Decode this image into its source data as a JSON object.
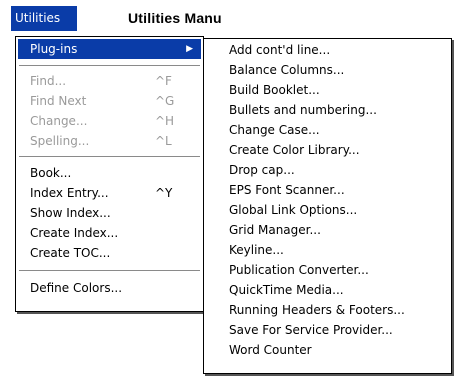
{
  "menubar": {
    "active_menu": "Utilities"
  },
  "caption": "Utilities  Manu",
  "utilities_menu": {
    "plugins": {
      "label": "Plug-ins",
      "arrow": "▶"
    },
    "find": {
      "label": "Find...",
      "shortcut": "^F"
    },
    "find_next": {
      "label": "Find Next",
      "shortcut": "^G"
    },
    "change": {
      "label": "Change...",
      "shortcut": "^H"
    },
    "spelling": {
      "label": "Spelling...",
      "shortcut": "^L"
    },
    "book": {
      "label": "Book..."
    },
    "index_entry": {
      "label": "Index Entry...",
      "shortcut": "^Y"
    },
    "show_index": {
      "label": "Show Index..."
    },
    "create_index": {
      "label": "Create Index..."
    },
    "create_toc": {
      "label": "Create TOC..."
    },
    "define_colors": {
      "label": "Define Colors..."
    }
  },
  "plugins_submenu": [
    "Add cont'd line...",
    "Balance Columns...",
    "Build Booklet...",
    "Bullets and numbering...",
    "Change Case...",
    "Create Color Library...",
    "Drop cap...",
    "EPS Font Scanner...",
    "Global Link Options...",
    "Grid Manager...",
    "Keyline...",
    "Publication Converter...",
    "QuickTime Media...",
    "Running Headers & Footers...",
    "Save For Service Provider...",
    "Word Counter"
  ],
  "colors": {
    "highlight": "#0a3ca8",
    "disabled_text": "#9a9a9a"
  }
}
